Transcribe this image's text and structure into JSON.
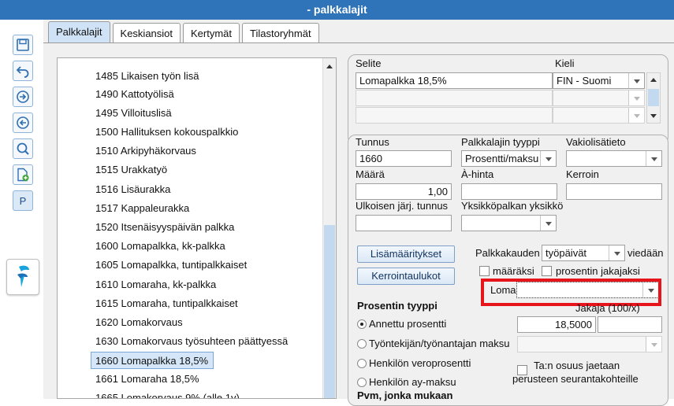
{
  "window": {
    "title": "- palkkalajit"
  },
  "toolbar": {
    "p_label": "P"
  },
  "tabs": [
    "Palkkalajit",
    "Keskiansiot",
    "Kertymät",
    "Tilastoryhmät"
  ],
  "list": {
    "items": [
      "1485 Likaisen työn lisä",
      "1490 Kattotyölisä",
      "1495 Villoituslisä",
      "1500 Hallituksen kokouspalkkio",
      "1510 Arkipyhäkorvaus",
      "1515 Urakkatyö",
      "1516 Lisäurakka",
      "1517 Kappaleurakka",
      "1520 Itsenäisyyspäivän palkka",
      "1600 Lomapalkka, kk-palkka",
      "1605 Lomapalkka, tuntipalkkaiset",
      "1610 Lomaraha, kk-palkka",
      "1615 Lomaraha, tuntipalkkaiset",
      "1620 Lomakorvaus",
      "1630 Lomakorvaus työsuhteen päättyessä",
      "1660 Lomapalkka 18,5%",
      "1661 Lomaraha 18,5%",
      "1665 Lomakorvaus 9% (alle 1v)"
    ],
    "selected": "1660 Lomapalkka 18,5%"
  },
  "description": {
    "selite_label": "Selite",
    "kieli_label": "Kieli",
    "selite_value": "Lomapalkka 18,5%",
    "kieli_value": "FIN - Suomi"
  },
  "details": {
    "tunnus_label": "Tunnus",
    "tunnus_value": "1660",
    "tyyppi_label": "Palkkalajin tyyppi",
    "tyyppi_value": "Prosentti/maksu",
    "vakio_label": "Vakiolisätieto",
    "vakio_value": "",
    "maara_label": "Määrä",
    "maara_value": "1,00",
    "ahinta_label": "À-hinta",
    "ahinta_value": "",
    "kerroin_label": "Kerroin",
    "kerroin_value": "",
    "ulkoinen_label": "Ulkoisen järj. tunnus",
    "ulkoinen_value": "",
    "yksikko_label": "Yksikköpalkan yksikkö",
    "yksikko_value": "",
    "lisamaaritykset_btn": "Lisämääritykset",
    "kerrointaulukot_btn": "Kerrointaulukot",
    "palkkakauden_label": "Palkkakauden",
    "tyopaivat_value": "työpäivät",
    "viedaan_label": "viedään",
    "maaraksi_label": "määräksi",
    "prosentin_jakajaksi_label": "prosentin jakajaksi",
    "loma_label": "Loma",
    "loma_value": "",
    "prosentin_tyyppi_heading": "Prosentin tyyppi",
    "jakaja_label": "Jakaja (100/x)",
    "annettu_label": "Annettu prosentti",
    "annettu_value": "18,5000",
    "tyontekijan_label": "Työntekijän/työnantajan maksu",
    "veroprosentti_label": "Henkilön veroprosentti",
    "ay_label": "Henkilön ay-maksu",
    "tan_osuus_label": "Ta:n osuus jaetaan",
    "perusteen_label": "perusteen seurantakohteille",
    "pvm_label": "Pvm, jonka mukaan"
  }
}
